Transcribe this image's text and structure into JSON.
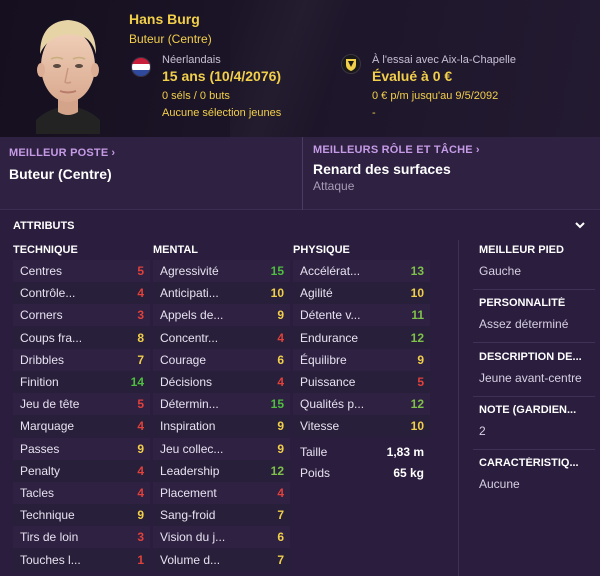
{
  "player": {
    "name": "Hans Burg",
    "role": "Buteur (Centre)",
    "nationality": "Néerlandais",
    "age": "15 ans (10/4/2076)",
    "caps": "0 séls / 0 buts",
    "youth": "Aucune sélection jeunes",
    "trial": "À l'essai avec Aix-la-Chapelle",
    "value": "Évalué à 0 €",
    "contract": "0 € p/m jusqu'au 9/5/2092",
    "contract_extra": "-"
  },
  "best_position": {
    "label": "MEILLEUR POSTE",
    "value": "Buteur (Centre)"
  },
  "best_role": {
    "label": "MEILLEURS RÔLE ET TÂCHE",
    "value": "Renard des surfaces",
    "sub": "Attaque"
  },
  "attributes": {
    "title": "ATTRIBUTS",
    "technique": {
      "heading": "TECHNIQUE",
      "items": [
        {
          "name": "Centres",
          "value": "5"
        },
        {
          "name": "Contrôle...",
          "value": "4"
        },
        {
          "name": "Corners",
          "value": "3"
        },
        {
          "name": "Coups fra...",
          "value": "8"
        },
        {
          "name": "Dribbles",
          "value": "7"
        },
        {
          "name": "Finition",
          "value": "14"
        },
        {
          "name": "Jeu de tête",
          "value": "5"
        },
        {
          "name": "Marquage",
          "value": "4"
        },
        {
          "name": "Passes",
          "value": "9"
        },
        {
          "name": "Penalty",
          "value": "4"
        },
        {
          "name": "Tacles",
          "value": "4"
        },
        {
          "name": "Technique",
          "value": "9"
        },
        {
          "name": "Tirs de loin",
          "value": "3"
        },
        {
          "name": "Touches l...",
          "value": "1"
        }
      ]
    },
    "mental": {
      "heading": "MENTAL",
      "items": [
        {
          "name": "Agressivité",
          "value": "15"
        },
        {
          "name": "Anticipati...",
          "value": "10"
        },
        {
          "name": "Appels de...",
          "value": "9"
        },
        {
          "name": "Concentr...",
          "value": "4"
        },
        {
          "name": "Courage",
          "value": "6"
        },
        {
          "name": "Décisions",
          "value": "4"
        },
        {
          "name": "Détermin...",
          "value": "15"
        },
        {
          "name": "Inspiration",
          "value": "9"
        },
        {
          "name": "Jeu collec...",
          "value": "9"
        },
        {
          "name": "Leadership",
          "value": "12"
        },
        {
          "name": "Placement",
          "value": "4"
        },
        {
          "name": "Sang-froid",
          "value": "7"
        },
        {
          "name": "Vision du j...",
          "value": "6"
        },
        {
          "name": "Volume d...",
          "value": "7"
        }
      ]
    },
    "physique": {
      "heading": "PHYSIQUE",
      "items": [
        {
          "name": "Accélérat...",
          "value": "13"
        },
        {
          "name": "Agilité",
          "value": "10"
        },
        {
          "name": "Détente v...",
          "value": "11"
        },
        {
          "name": "Endurance",
          "value": "12"
        },
        {
          "name": "Équilibre",
          "value": "9"
        },
        {
          "name": "Puissance",
          "value": "5"
        },
        {
          "name": "Qualités p...",
          "value": "12"
        },
        {
          "name": "Vitesse",
          "value": "10"
        }
      ],
      "height_label": "Taille",
      "height_value": "1,83 m",
      "weight_label": "Poids",
      "weight_value": "65 kg"
    }
  },
  "info": [
    {
      "label": "MEILLEUR PIED",
      "value": "Gauche"
    },
    {
      "label": "PERSONNALITÉ",
      "value": "Assez déterminé"
    },
    {
      "label": "DESCRIPTION DE...",
      "value": "Jeune avant-centre"
    },
    {
      "label": "NOTE (GARDIEN...",
      "value": "2"
    },
    {
      "label": "CARACTÉRISTIQ...",
      "value": "Aucune"
    }
  ],
  "colors": {
    "low": "#e0413a",
    "mid": "#f2cf4a",
    "good": "#7fc24a",
    "high": "#4fbf3f"
  },
  "icons": {
    "flag": "netherlands-flag-icon",
    "club": "club-crest-icon",
    "collapse": "chevron-down-icon"
  }
}
